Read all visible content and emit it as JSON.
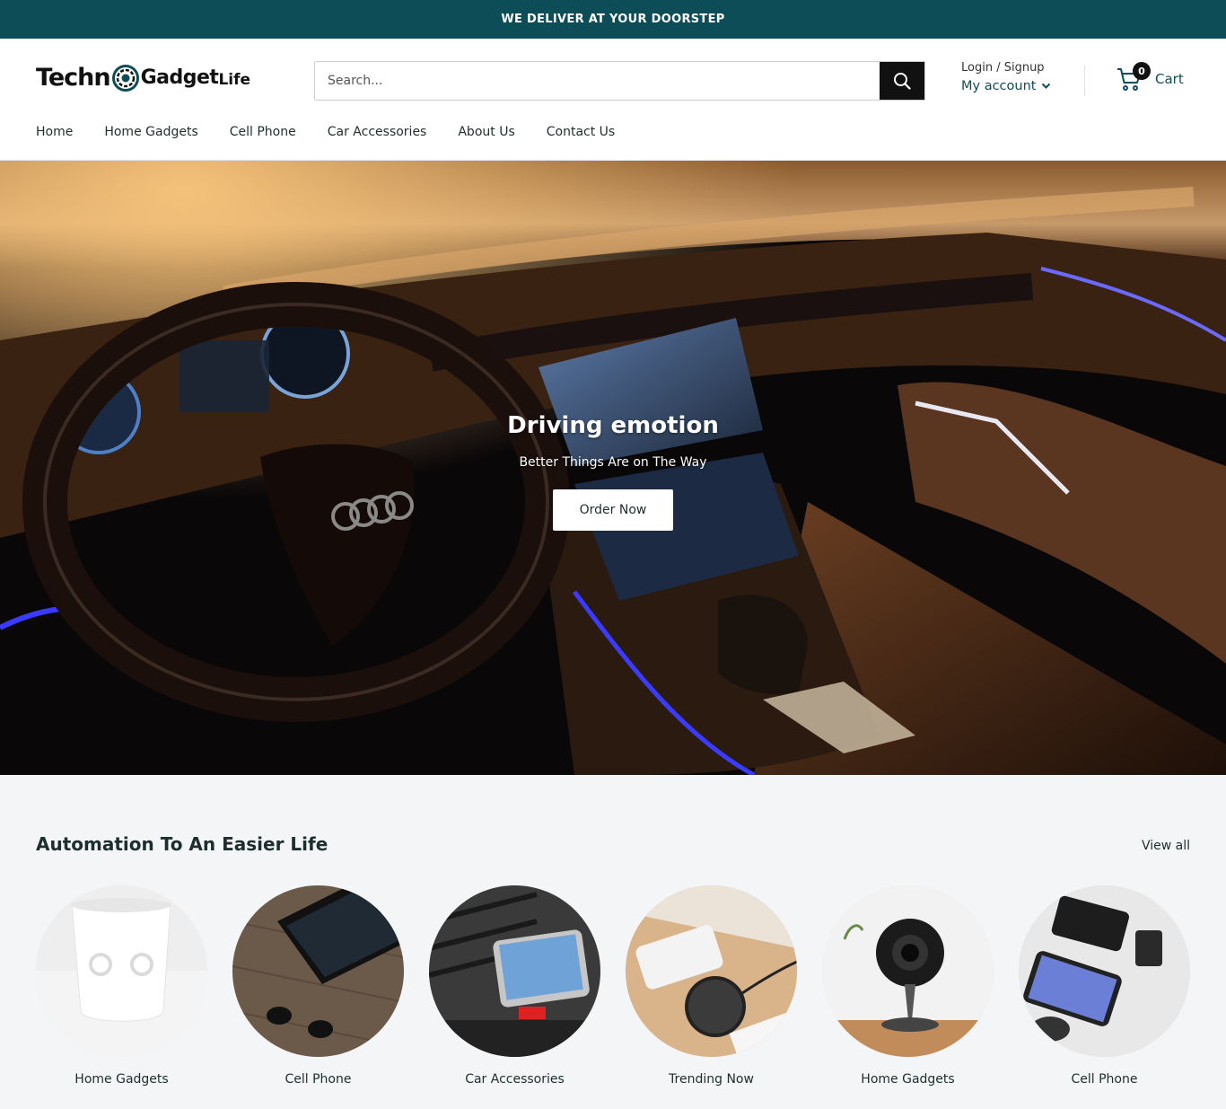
{
  "announcement": "WE DELIVER AT YOUR DOORSTEP",
  "logo": {
    "part1": "Techn",
    "part2": "Gadget",
    "part3": "Life"
  },
  "search": {
    "placeholder": "Search..."
  },
  "account": {
    "login": "Login / Signup",
    "my_account": "My account"
  },
  "cart": {
    "count": "0",
    "label": "Cart"
  },
  "nav": [
    "Home",
    "Home Gadgets",
    "Cell Phone",
    "Car Accessories",
    "About Us",
    "Contact Us"
  ],
  "hero": {
    "title": "Driving emotion",
    "subtitle": "Better Things Are on The Way",
    "cta": "Order Now"
  },
  "collections": {
    "title": "Automation To An Easier Life",
    "view_all": "View all",
    "items": [
      "Home Gadgets",
      "Cell Phone",
      "Car Accessories",
      "Trending Now",
      "Home Gadgets",
      "Cell Phone"
    ]
  },
  "colors": {
    "brand": "#0d4d58",
    "dark": "#111111",
    "bg": "#f3f5f6"
  }
}
